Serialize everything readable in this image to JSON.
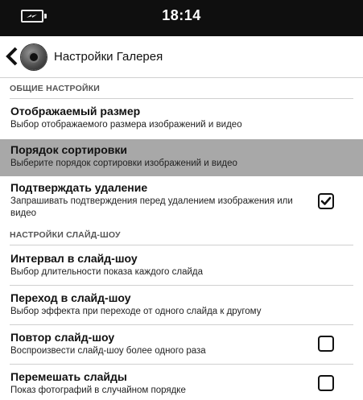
{
  "status_bar": {
    "time": "18:14",
    "battery_icon": "battery-charging-icon"
  },
  "app_bar": {
    "title": "Настройки Галерея",
    "back_icon": "chevron-left-icon",
    "app_icon": "gallery-app-icon"
  },
  "sections": {
    "general": "ОБЩИЕ НАСТРОЙКИ",
    "slideshow": "НАСТРОЙКИ СЛАЙД-ШОУ"
  },
  "prefs": {
    "display_size": {
      "title": "Отображаемый размер",
      "summary": "Выбор отображаемого размера изображений и видео"
    },
    "sort_order": {
      "title": "Порядок сортировки",
      "summary": "Выберите порядок сортировки изображений и видео"
    },
    "confirm_delete": {
      "title": "Подтверждать удаление",
      "summary": "Запрашивать подтверждения перед удалением изображения или видео",
      "checked": true
    },
    "slide_interval": {
      "title": "Интервал в слайд-шоу",
      "summary": "Выбор длительности показа каждого слайда"
    },
    "slide_transition": {
      "title": "Переход в слайд-шоу",
      "summary": "Выбор эффекта при переходе от одного слайда к другому"
    },
    "slide_repeat": {
      "title": "Повтор слайд-шоу",
      "summary": "Воспроизвести слайд-шоу более одного раза",
      "checked": false
    },
    "slide_shuffle": {
      "title": "Перемешать слайды",
      "summary": "Показ фотографий в случайном порядке",
      "checked": false
    }
  },
  "colors": {
    "status_bar": "#0f0f0f",
    "highlight": "#a8a8a8"
  }
}
